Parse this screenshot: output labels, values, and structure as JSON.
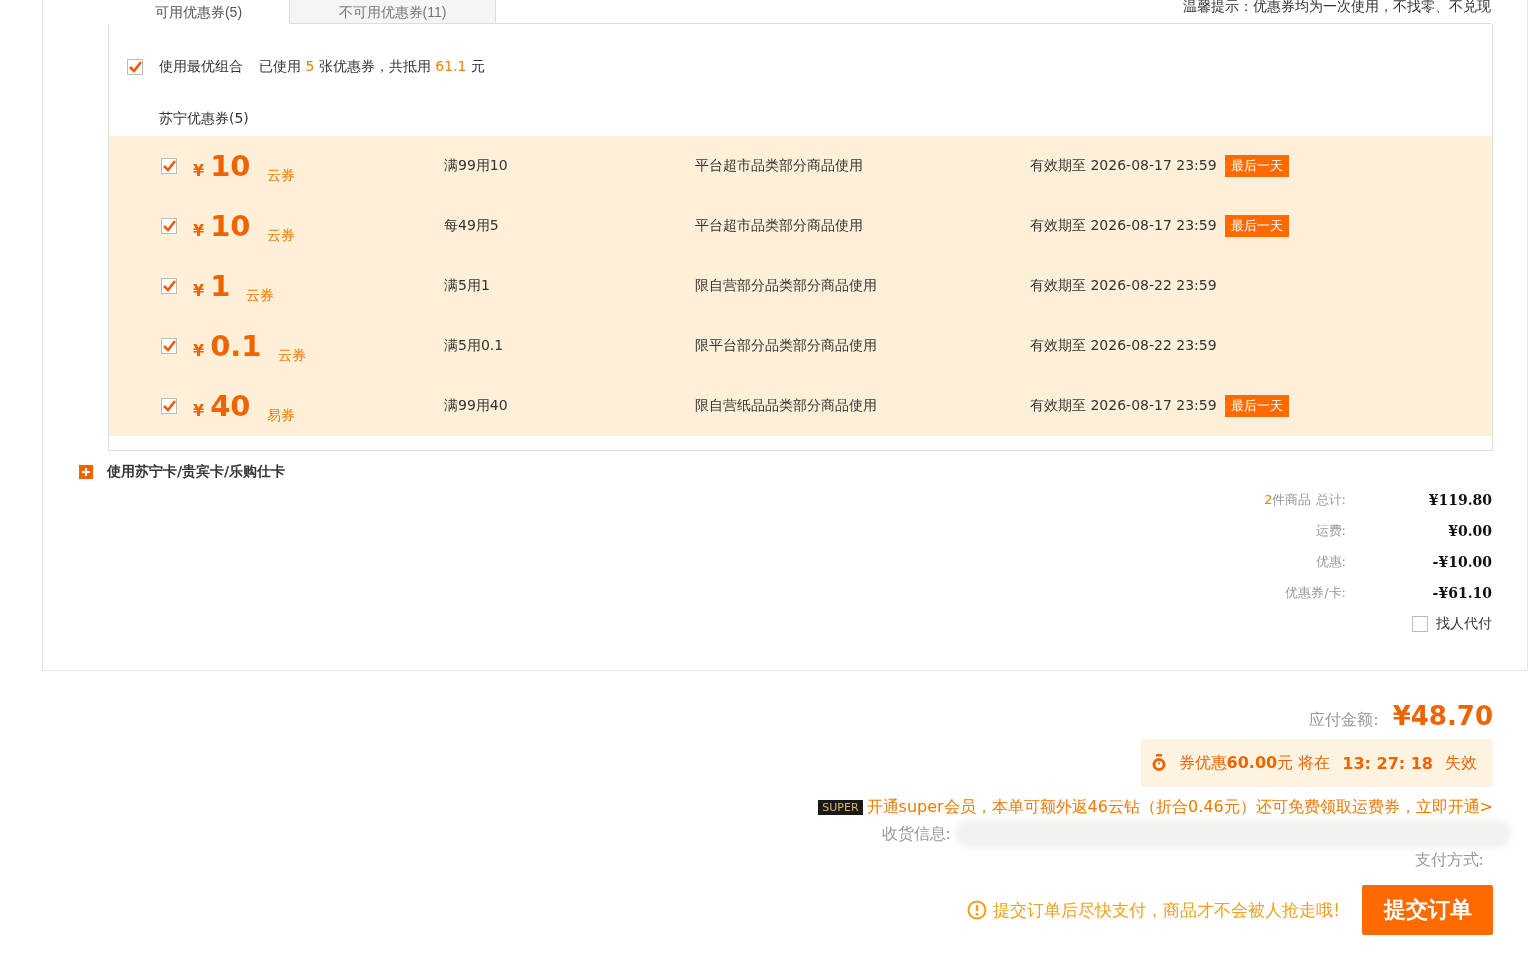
{
  "tabs": [
    {
      "label": "可用优惠券(5)",
      "selected": true
    },
    {
      "label": "不可用优惠券(11)",
      "selected": false
    }
  ],
  "tip": "温馨提示：优惠券均为一次使用，不找零、不兑现",
  "best_combo": {
    "checked": true,
    "label": "使用最优组合",
    "summary": "已使用 **5** 张优惠券，共抵用 **61.1** 元"
  },
  "group_title": "苏宁优惠券(5)",
  "coupons": [
    {
      "checked": true,
      "currency": "¥",
      "amount": "10",
      "type": "云券",
      "rule": "满99用10",
      "scope": "平台超市品类部分商品使用",
      "expiry": "有效期至 2026-08-17 23:59",
      "tag": "最后一天"
    },
    {
      "checked": true,
      "currency": "¥",
      "amount": "10",
      "type": "云券",
      "rule": "每49用5",
      "scope": "平台超市品类部分商品使用",
      "expiry": "有效期至 2026-08-17 23:59",
      "tag": "最后一天"
    },
    {
      "checked": true,
      "currency": "¥",
      "amount": "1",
      "type": "云券",
      "rule": "满5用1",
      "scope": "限自营部分品类部分商品使用",
      "expiry": "有效期至 2026-08-22 23:59"
    },
    {
      "checked": true,
      "currency": "¥",
      "amount": "0.1",
      "type": "云券",
      "rule": "满5用0.1",
      "scope": "限平台部分品类部分商品使用",
      "expiry": "有效期至 2026-08-22 23:59"
    },
    {
      "checked": true,
      "currency": "¥",
      "amount": "40",
      "type": "易券",
      "rule": "满99用40",
      "scope": "限自营纸品品类部分商品使用",
      "expiry": "有效期至 2026-08-17 23:59",
      "tag": "最后一天"
    }
  ],
  "cards_toggle": {
    "label": "使用苏宁卡/贵宾卡/乐购仕卡"
  },
  "summary": [
    {
      "label": "**2**件商品 总计:",
      "value": "¥119.80"
    },
    {
      "label": "运费:",
      "value": "¥0.00"
    },
    {
      "label": "优惠:",
      "value": "-¥10.00"
    },
    {
      "label": "优惠券/卡:",
      "value": "-¥61.10"
    }
  ],
  "pay_for_me": {
    "checked": false,
    "label": "找人代付"
  },
  "payable": {
    "label": "应付金额:",
    "value": "¥48.70"
  },
  "countdown": {
    "text": "券优惠**60.00**元 将在",
    "time": "13: 27: 18",
    "suffix": "失效"
  },
  "super": {
    "badge": "SUPER",
    "text": "开通super会员，本单可额外返46云钻（折合0.46元）还可免费领取运费券，立即开通>"
  },
  "shipping": {
    "label": "收货信息:"
  },
  "payment": {
    "label": "支付方式:"
  },
  "reminder": "提交订单后尽快支付，商品才不会被人抢走哦!",
  "submit": "提交订单"
}
